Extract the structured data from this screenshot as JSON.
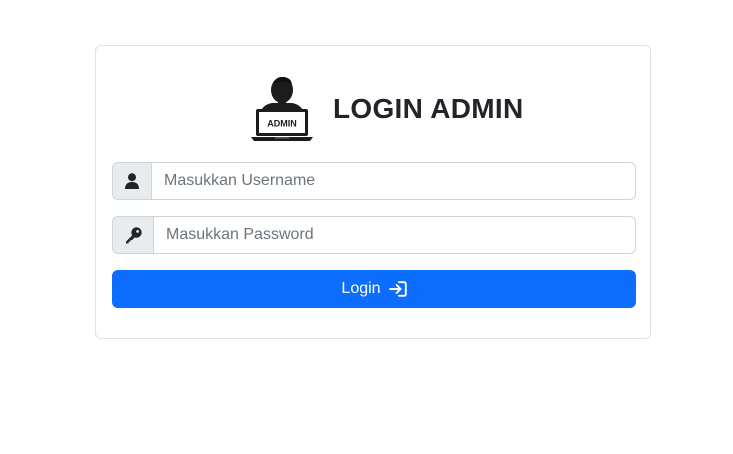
{
  "header": {
    "title": "LOGIN ADMIN",
    "logo_text": "ADMIN",
    "logo_icon": "admin-laptop-icon"
  },
  "form": {
    "username": {
      "icon": "user-icon",
      "value": "",
      "placeholder": "Masukkan Username"
    },
    "password": {
      "icon": "key-icon",
      "value": "",
      "placeholder": "Masukkan Password"
    },
    "submit": {
      "label": "Login",
      "icon": "sign-in-icon"
    }
  },
  "colors": {
    "primary": "#0d6efd",
    "addon_bg": "#e9ecef",
    "border": "#ced4da",
    "text": "#212529"
  }
}
